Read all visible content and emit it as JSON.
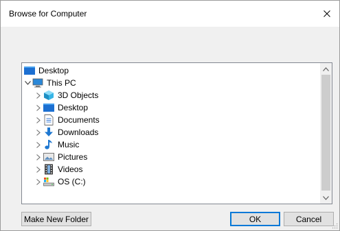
{
  "window": {
    "title": "Browse for Computer"
  },
  "tree": {
    "root": {
      "label": "Desktop",
      "icon": "desktop-folder-icon"
    },
    "this_pc": {
      "label": "This PC",
      "icon": "computer-icon",
      "expanded": true
    },
    "items": [
      {
        "label": "3D Objects",
        "icon": "3d-objects-icon"
      },
      {
        "label": "Desktop",
        "icon": "desktop-folder-icon"
      },
      {
        "label": "Documents",
        "icon": "documents-icon"
      },
      {
        "label": "Downloads",
        "icon": "downloads-icon"
      },
      {
        "label": "Music",
        "icon": "music-icon"
      },
      {
        "label": "Pictures",
        "icon": "pictures-icon"
      },
      {
        "label": "Videos",
        "icon": "videos-icon"
      },
      {
        "label": "OS (C:)",
        "icon": "drive-icon"
      }
    ]
  },
  "buttons": {
    "make_new_folder": "Make New Folder",
    "ok": "OK",
    "cancel": "Cancel"
  },
  "colors": {
    "accent": "#0078d7",
    "folder_blue": "#1c6fd1"
  }
}
